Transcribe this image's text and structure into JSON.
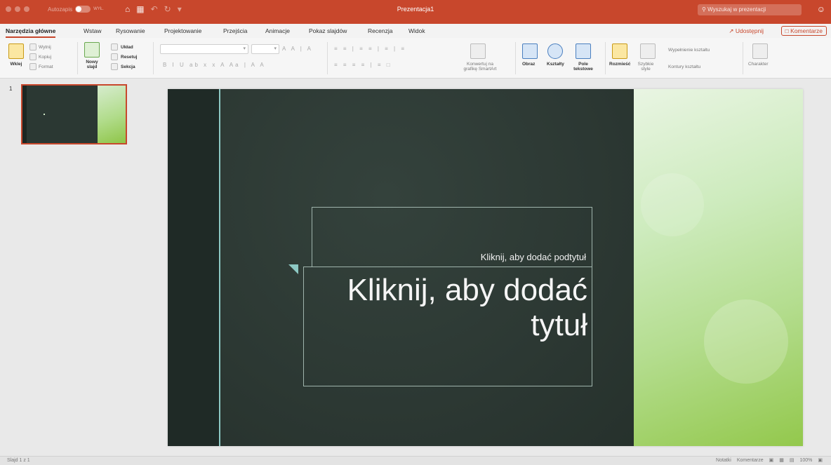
{
  "titlebar": {
    "autosave_label": "Autozapis",
    "autosave_state": "WYŁ.",
    "document_title": "Prezentacja1",
    "search_placeholder": "Wyszukaj w prezentacji",
    "icons": [
      "home-icon",
      "save-icon",
      "undo-icon",
      "redo-icon",
      "customize-qat-icon",
      "account-icon"
    ],
    "accent_color": "#c8472c"
  },
  "tabs": [
    {
      "label": "Narzędzia główne",
      "active": true
    },
    {
      "label": "Wstaw"
    },
    {
      "label": "Rysowanie"
    },
    {
      "label": "Projektowanie"
    },
    {
      "label": "Przejścia"
    },
    {
      "label": "Animacje"
    },
    {
      "label": "Pokaz slajdów"
    },
    {
      "label": "Recenzja"
    },
    {
      "label": "Widok"
    }
  ],
  "share_label": "Udostępnij",
  "comments_label": "Komentarze",
  "ribbon": {
    "paste": "Wklej",
    "cut": "Wytnij",
    "copy": "Kopiuj",
    "format": "Format",
    "new_slide": "Nowy slajd",
    "layout": "Układ",
    "reset": "Resetuj",
    "section": "Sekcja",
    "smartart": "Konwertuj na grafikę SmartArt",
    "picture": "Obraz",
    "shapes": "Kształty",
    "textbox": "Pole tekstowe",
    "arrange": "Rozmieść",
    "quick_styles": "Szybkie style",
    "shape_fill": "Wypełnienie kształtu",
    "shape_outline": "Kontury kształtu",
    "character": "Charakter"
  },
  "panel": {
    "slide_number": "1"
  },
  "slide": {
    "subtitle_placeholder": "Kliknij, aby dodać podtytuł",
    "title_placeholder": "Kliknij, aby dodać tytuł",
    "colors": {
      "dark": "#2e3a35",
      "accent": "#8dc9c4",
      "green": "#93c84c"
    }
  },
  "status": {
    "slide_info": "Slajd 1 z 1",
    "notes": "Notatki",
    "comments": "Komentarze",
    "zoom": "100%"
  }
}
